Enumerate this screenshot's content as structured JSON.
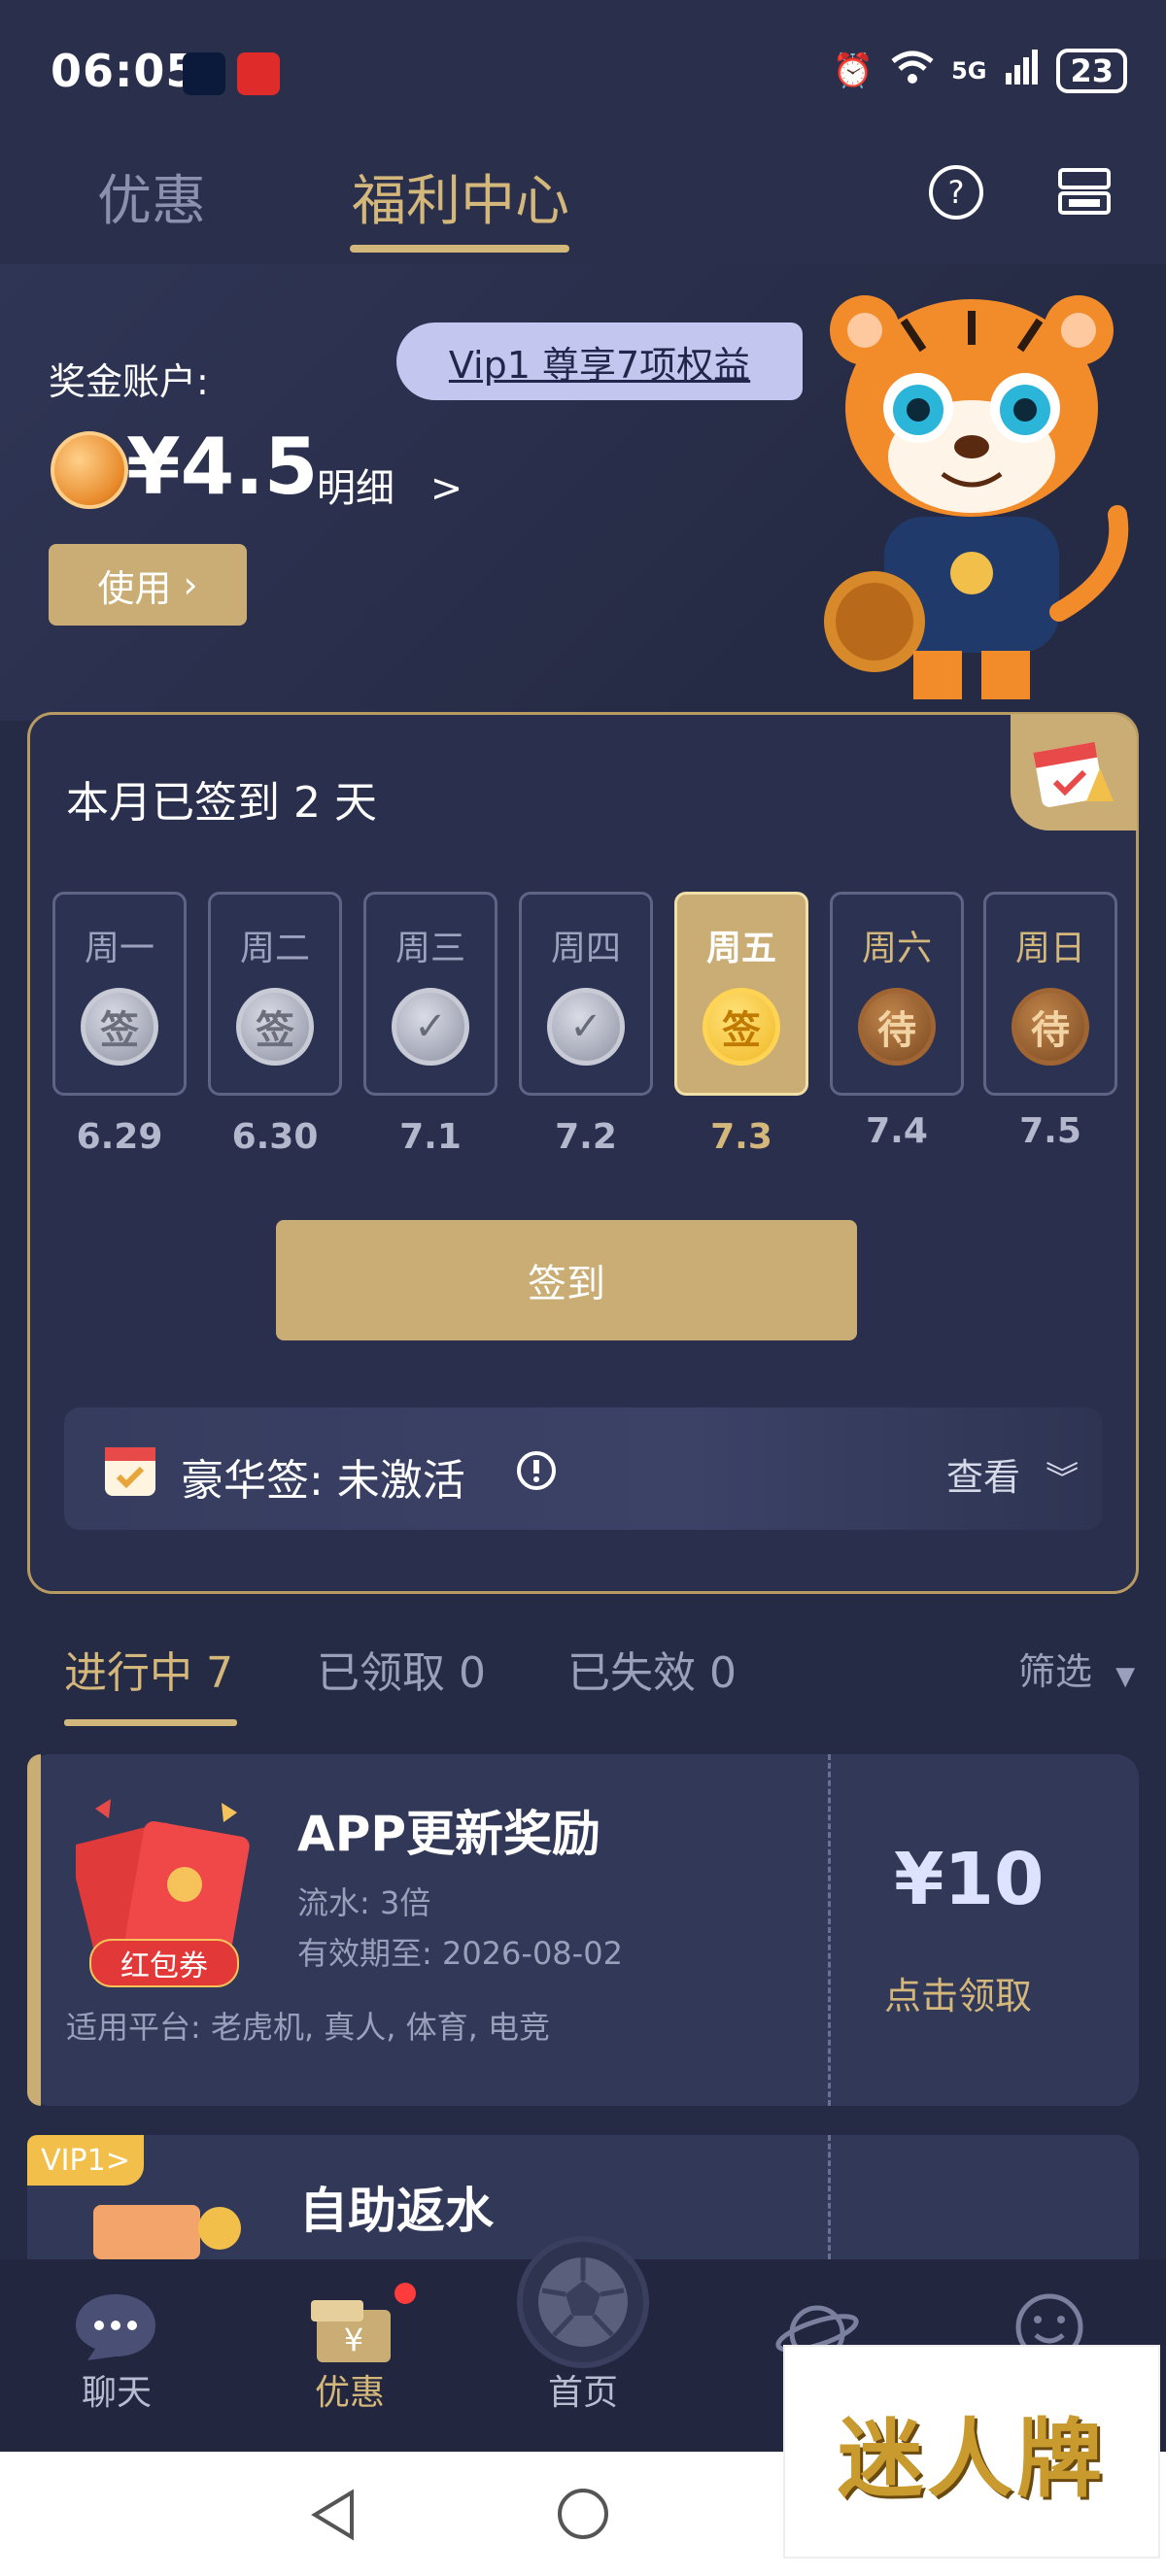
{
  "status_bar": {
    "time": "06:05",
    "network": "5G",
    "battery": "23"
  },
  "header": {
    "tabs": [
      {
        "label": "优惠"
      },
      {
        "label": "福利中心"
      }
    ],
    "active_tab": "福利中心",
    "accent": "#d4b77a"
  },
  "hero": {
    "vip_pill": "Vip1 尊享7项权益",
    "account_label": "奖金账户:",
    "balance": "¥4.5",
    "detail_label": "明细",
    "use_button": "使用"
  },
  "checkin": {
    "title": "本月已签到 2 天",
    "days": [
      {
        "name": "周一",
        "date": "6.29",
        "badge": "签",
        "state": "signed"
      },
      {
        "name": "周二",
        "date": "6.30",
        "badge": "签",
        "state": "signed"
      },
      {
        "name": "周三",
        "date": "7.1",
        "badge": "✓",
        "state": "check"
      },
      {
        "name": "周四",
        "date": "7.2",
        "badge": "✓",
        "state": "check"
      },
      {
        "name": "周五",
        "date": "7.3",
        "badge": "签",
        "state": "today"
      },
      {
        "name": "周六",
        "date": "7.4",
        "badge": "待",
        "state": "pending"
      },
      {
        "name": "周日",
        "date": "7.5",
        "badge": "待",
        "state": "pending"
      }
    ],
    "sign_button": "签到",
    "luxury_label": "豪华签: 未激活",
    "luxury_view": "查看"
  },
  "filter_tabs": [
    {
      "label": "进行中 7"
    },
    {
      "label": "已领取 0"
    },
    {
      "label": "已失效 0"
    }
  ],
  "filter_label": "筛选",
  "coupons": [
    {
      "title": "APP更新奖励",
      "badge": "红包券",
      "turnover": "流水: 3倍",
      "expiry": "有效期至: 2026-08-02",
      "platforms": "适用平台: 老虎机, 真人, 体育, 电竞",
      "amount": "¥10",
      "claim": "点击领取"
    },
    {
      "title": "自助返水",
      "tag": "VIP1>"
    }
  ],
  "bottom_nav": [
    {
      "label": "聊天",
      "icon": "chat-icon"
    },
    {
      "label": "优惠",
      "icon": "coupon-icon"
    },
    {
      "label": "首页",
      "icon": "soccer-ball-icon"
    },
    {
      "label": "",
      "icon": "planet-icon"
    },
    {
      "label": "",
      "icon": "smile-icon"
    }
  ],
  "watermark": "迷人牌"
}
